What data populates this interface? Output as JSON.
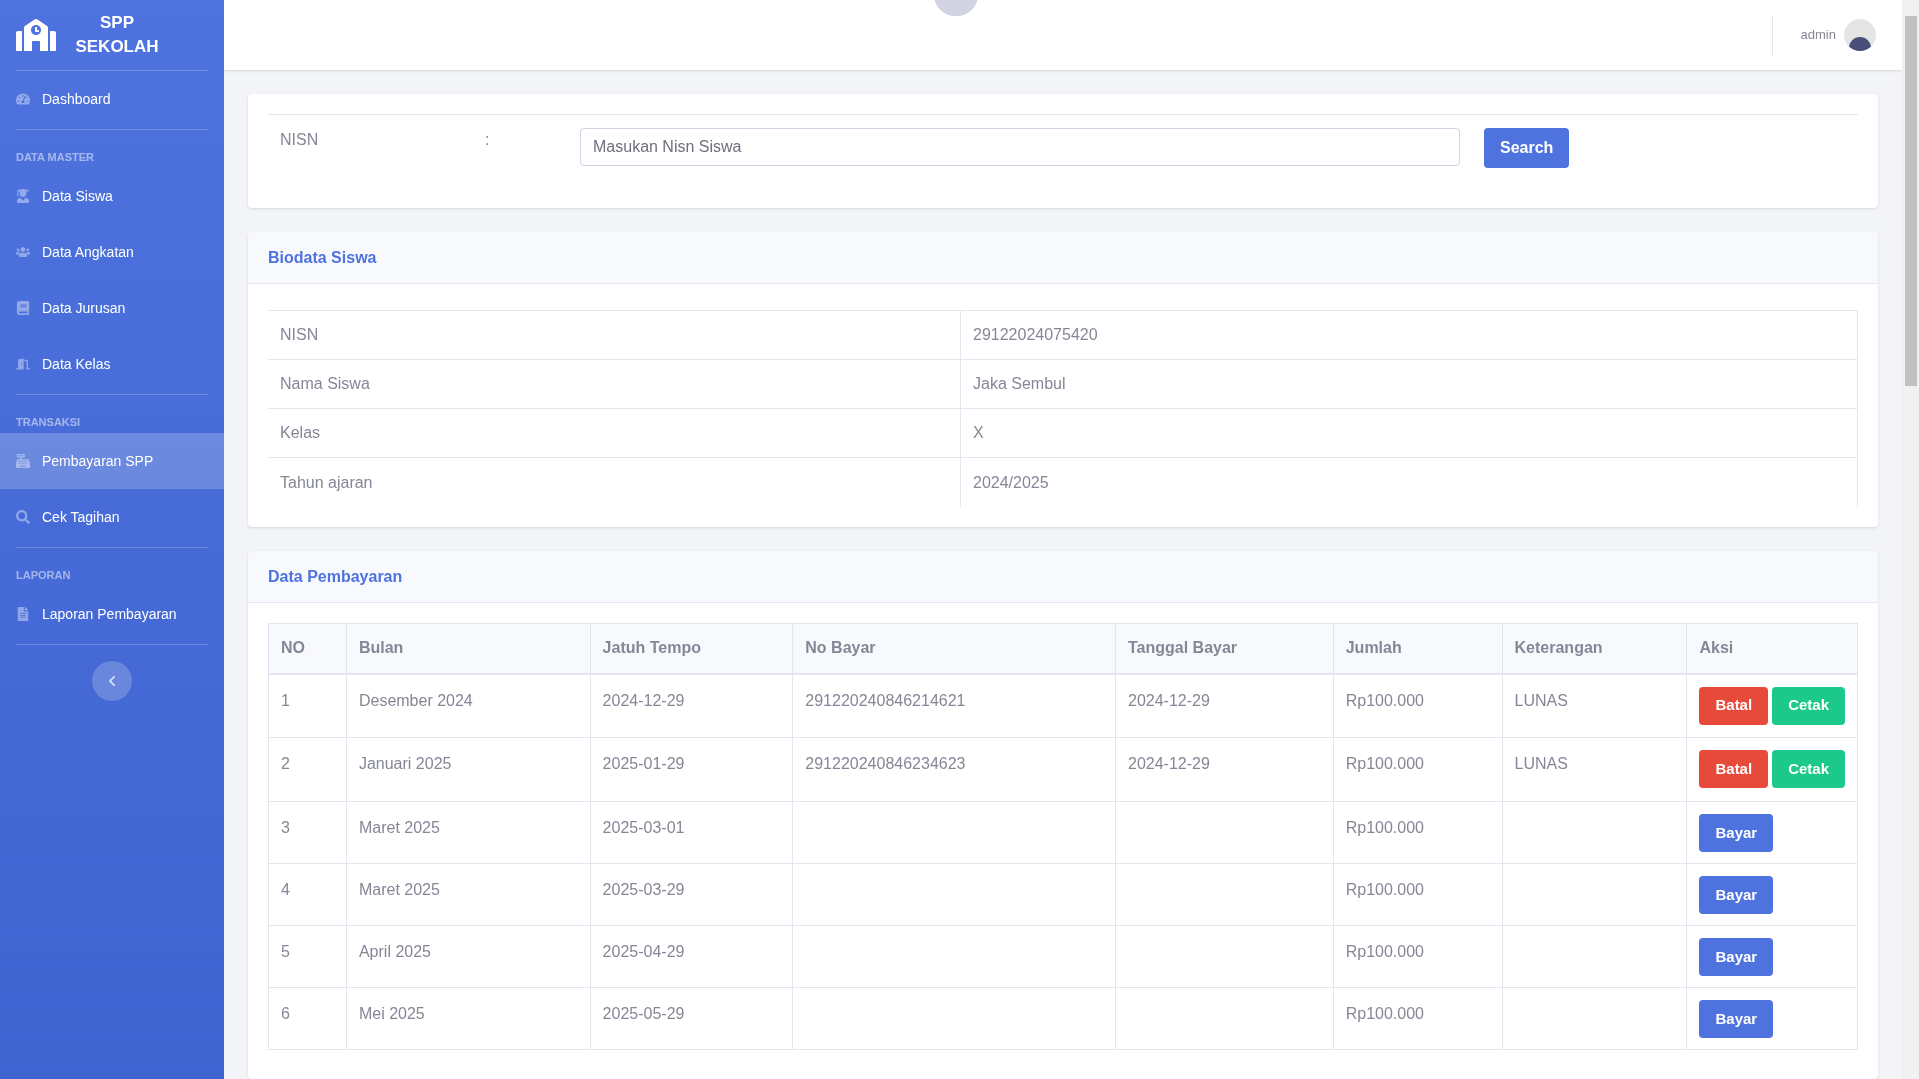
{
  "sidebar": {
    "brand": "SPP SEKOLAH",
    "items": [
      {
        "kind": "link",
        "label": "Dashboard",
        "selected": false
      },
      {
        "kind": "heading",
        "label": "DATA MASTER"
      },
      {
        "kind": "link",
        "label": "Data Siswa",
        "selected": false
      },
      {
        "kind": "link",
        "label": "Data Angkatan",
        "selected": false
      },
      {
        "kind": "link",
        "label": "Data Jurusan",
        "selected": false
      },
      {
        "kind": "link",
        "label": "Data Kelas",
        "selected": false
      },
      {
        "kind": "heading",
        "label": "TRANSAKSI"
      },
      {
        "kind": "link",
        "label": "Pembayaran SPP",
        "selected": true
      },
      {
        "kind": "link",
        "label": "Cek Tagihan",
        "selected": false
      },
      {
        "kind": "heading",
        "label": "LAPORAN"
      },
      {
        "kind": "link",
        "label": "Laporan Pembayaran",
        "selected": false
      }
    ]
  },
  "topbar": {
    "user": "admin"
  },
  "search_form": {
    "label": "NISN",
    "separator": ":",
    "placeholder": "Masukan Nisn Siswa",
    "button": "Search"
  },
  "biodata": {
    "title": "Biodata Siswa",
    "rows": [
      {
        "label": "NISN",
        "value": "29122024075420"
      },
      {
        "label": "Nama Siswa",
        "value": "Jaka Sembul"
      },
      {
        "label": "Kelas",
        "value": "X"
      },
      {
        "label": "Tahun ajaran",
        "value": "2024/2025"
      }
    ]
  },
  "payments": {
    "title": "Data Pembayaran",
    "columns": [
      "NO",
      "Bulan",
      "Jatuh Tempo",
      "No Bayar",
      "Tanggal Bayar",
      "Jumlah",
      "Keterangan",
      "Aksi"
    ],
    "rows": [
      {
        "cells": [
          "1",
          "Desember 2024",
          "2024-12-29",
          "291220240846214621",
          "2024-12-29",
          "Rp100.000",
          "LUNAS"
        ],
        "actions": [
          {
            "kind": "cancel",
            "label": "Batal"
          },
          {
            "kind": "print",
            "label": "Cetak"
          }
        ]
      },
      {
        "cells": [
          "2",
          "Januari 2025",
          "2025-01-29",
          "291220240846234623",
          "2024-12-29",
          "Rp100.000",
          "LUNAS"
        ],
        "actions": [
          {
            "kind": "cancel",
            "label": "Batal"
          },
          {
            "kind": "print",
            "label": "Cetak"
          }
        ]
      },
      {
        "cells": [
          "3",
          "Maret 2025",
          "2025-03-01",
          "",
          "",
          "Rp100.000",
          ""
        ],
        "actions": [
          {
            "kind": "pay",
            "label": "Bayar"
          }
        ]
      },
      {
        "cells": [
          "4",
          "Maret 2025",
          "2025-03-29",
          "",
          "",
          "Rp100.000",
          ""
        ],
        "actions": [
          {
            "kind": "pay",
            "label": "Bayar"
          }
        ]
      },
      {
        "cells": [
          "5",
          "April 2025",
          "2025-04-29",
          "",
          "",
          "Rp100.000",
          ""
        ],
        "actions": [
          {
            "kind": "pay",
            "label": "Bayar"
          }
        ]
      },
      {
        "cells": [
          "6",
          "Mei 2025",
          "2025-05-29",
          "",
          "",
          "Rp100.000",
          ""
        ],
        "actions": [
          {
            "kind": "pay",
            "label": "Bayar"
          }
        ]
      }
    ]
  }
}
